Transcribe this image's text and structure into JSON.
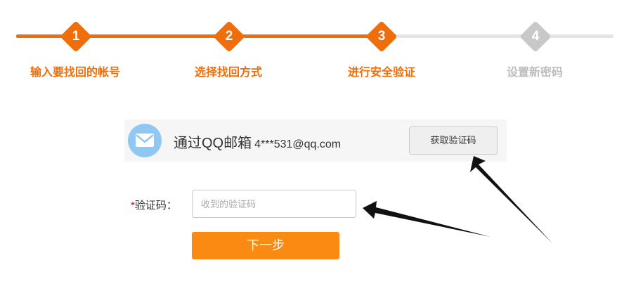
{
  "steps": [
    {
      "number": "1",
      "label": "输入要找回的帐号",
      "state": "done"
    },
    {
      "number": "2",
      "label": "选择找回方式",
      "state": "done"
    },
    {
      "number": "3",
      "label": "进行安全验证",
      "state": "current"
    },
    {
      "number": "4",
      "label": "设置新密码",
      "state": "pending"
    }
  ],
  "method": {
    "icon": "envelope-icon",
    "label": "通过QQ邮箱",
    "address": "4***531@qq.com",
    "get_code_button": "获取验证码"
  },
  "form": {
    "required_mark": "*",
    "code_label": "验证码：",
    "code_value": "",
    "code_placeholder": "收到的验证码",
    "next_button": "下一步"
  },
  "colors": {
    "accent": "#f06e0a",
    "button": "#fb8a13",
    "pending": "#c8c8c8",
    "track_pending": "#e4e4e4",
    "required": "#e0001b",
    "mail_icon_bg": "#8fc8f2"
  }
}
